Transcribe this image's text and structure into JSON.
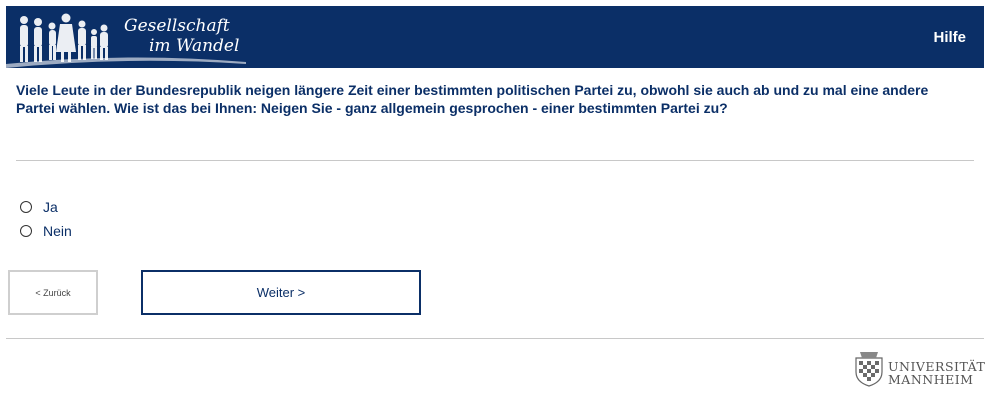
{
  "header": {
    "brand_line1": "Gesellschaft",
    "brand_line2": "im Wandel",
    "help_label": "Hilfe"
  },
  "question": {
    "text": "Viele Leute in der Bundesrepublik neigen längere Zeit einer bestimmten politischen Partei zu, obwohl sie auch ab und zu mal eine andere Partei wählen. Wie ist das bei Ihnen: Neigen Sie - ganz allgemein gesprochen - einer bestimmten Partei zu?"
  },
  "options": [
    {
      "label": "Ja",
      "selected": false
    },
    {
      "label": "Nein",
      "selected": false
    }
  ],
  "navigation": {
    "back_label": "< Zurück",
    "next_label": "Weiter >"
  },
  "footer": {
    "university_line1": "UNIVERSITÄT",
    "university_line2": "MANNHEIM"
  },
  "colors": {
    "brand_navy": "#0b2f67",
    "divider": "#c8c8c8"
  }
}
